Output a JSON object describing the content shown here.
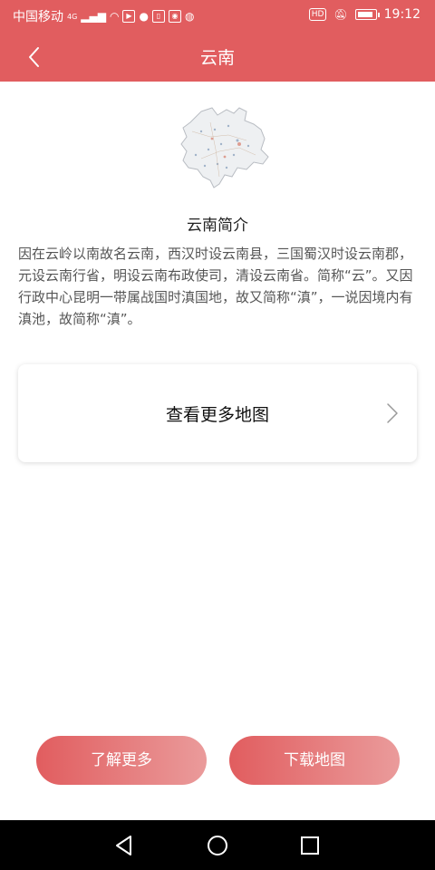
{
  "status_bar": {
    "carrier": "中国移动",
    "network": "4G",
    "time": "19:12",
    "hd_badge": "HD",
    "icons": [
      "signal-icon",
      "wifi-icon",
      "play-icon",
      "chat-bubble-icon",
      "sim-icon",
      "map-pin-icon",
      "wechat-icon",
      "mute-icon",
      "battery-icon"
    ]
  },
  "header": {
    "title": "云南",
    "back_icon": "chevron-left-icon"
  },
  "intro": {
    "map_icon": "yunnan-map-icon",
    "title": "云南简介",
    "body": "因在云岭以南故名云南，西汉时设云南县，三国蜀汉时设云南郡，元设云南行省，明设云南布政使司，清设云南省。简称“云”。又因行政中心昆明一带属战国时滇国地，故又简称“滇”，一说因境内有滇池，故简称“滇”。"
  },
  "more_maps": {
    "label": "查看更多地图",
    "chevron_icon": "chevron-right-icon"
  },
  "actions": {
    "learn_more": "了解更多",
    "download_map": "下载地图"
  },
  "colors": {
    "primary": "#e15d5f",
    "gradient_end": "#ea9b9b",
    "text_dark": "#222222",
    "text_body": "#555555",
    "system_nav": "#000000"
  }
}
